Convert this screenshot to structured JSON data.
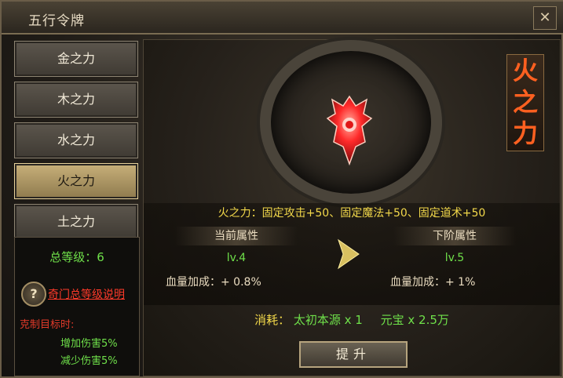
{
  "window": {
    "title": "五行令牌",
    "close_label": "✕"
  },
  "tabs": [
    {
      "label": "金之力",
      "active": false
    },
    {
      "label": "木之力",
      "active": false
    },
    {
      "label": "水之力",
      "active": false
    },
    {
      "label": "火之力",
      "active": true
    },
    {
      "label": "土之力",
      "active": false
    }
  ],
  "left_panel": {
    "total_level": "总等级：6",
    "help_icon": "?",
    "help_link": "奇门总等级说明",
    "counter_title": "克制目标时:",
    "counter_lines": [
      "增加伤害5%",
      "减少伤害5%"
    ]
  },
  "main": {
    "banner": "火之力",
    "description": "火之力：固定攻击+50、固定魔法+50、固定道术+50",
    "current": {
      "header": "当前属性",
      "level": "lv.4",
      "hp_label": "血量加成：",
      "hp_value": "+ 0.8%"
    },
    "next": {
      "header": "下阶属性",
      "level": "lv.5",
      "hp_label": "血量加成：",
      "hp_value": "+ 1%"
    },
    "cost": {
      "label": "消耗：",
      "item": "太初本源 x 1",
      "currency": "元宝 x 2.5万"
    },
    "upgrade_label": "提升",
    "icons": {
      "emblem": "fire-token-emblem-icon",
      "arrow": "arrow-right-icon"
    }
  },
  "colors": {
    "accent_green": "#6fe04a",
    "accent_yellow": "#f2d84a",
    "accent_red": "#ff3a2a",
    "banner_fire": "#ff6020"
  }
}
